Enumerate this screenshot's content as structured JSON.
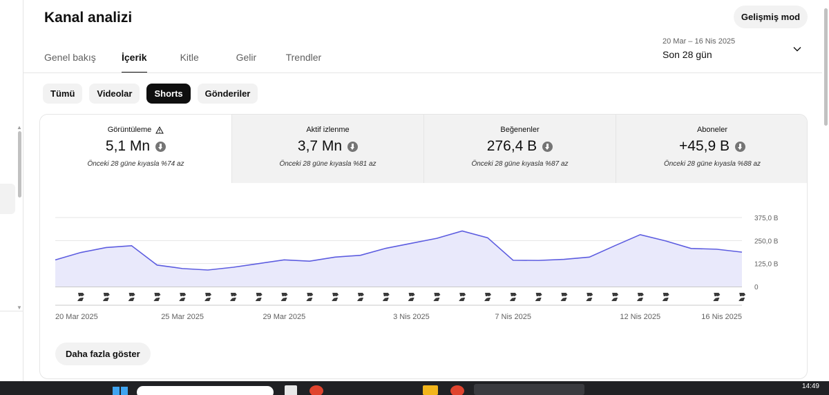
{
  "header": {
    "title": "Kanal analizi",
    "advanced_mode": "Gelişmiş mod"
  },
  "tabs": [
    {
      "label": "Genel bakış",
      "active": false
    },
    {
      "label": "İçerik",
      "active": true
    },
    {
      "label": "Kitle",
      "active": false
    },
    {
      "label": "Gelir",
      "active": false
    },
    {
      "label": "Trendler",
      "active": false
    }
  ],
  "date_picker": {
    "range": "20 Mar – 16 Nis 2025",
    "label": "Son 28 gün"
  },
  "filters": [
    {
      "label": "Tümü",
      "active": false
    },
    {
      "label": "Videolar",
      "active": false
    },
    {
      "label": "Shorts",
      "active": true
    },
    {
      "label": "Gönderiler",
      "active": false
    }
  ],
  "metrics": [
    {
      "title": "Görüntüleme",
      "value": "5,1 Mn",
      "compare": "Önceki 28 güne kıyasla %74 az",
      "warning": true,
      "active": true
    },
    {
      "title": "Aktif izlenme",
      "value": "3,7 Mn",
      "compare": "Önceki 28 güne kıyasla %81 az",
      "warning": false,
      "active": false
    },
    {
      "title": "Beğenenler",
      "value": "276,4 B",
      "compare": "Önceki 28 güne kıyasla %87 az",
      "warning": false,
      "active": false
    },
    {
      "title": "Aboneler",
      "value": "+45,9 B",
      "compare": "Önceki 28 güne kıyasla %88 az",
      "warning": false,
      "active": false
    }
  ],
  "chart_data": {
    "type": "area",
    "y_ticks": [
      {
        "value": 0,
        "label": "0"
      },
      {
        "value": 125000,
        "label": "125,0 B"
      },
      {
        "value": 250000,
        "label": "250,0 B"
      },
      {
        "value": 375000,
        "label": "375,0 B"
      }
    ],
    "ylim": [
      0,
      375000
    ],
    "x_tick_labels": [
      {
        "index": 0,
        "label": "20 Mar 2025"
      },
      {
        "index": 5,
        "label": "25 Mar 2025"
      },
      {
        "index": 9,
        "label": "29 Mar 2025"
      },
      {
        "index": 14,
        "label": "3 Nis 2025"
      },
      {
        "index": 18,
        "label": "7 Nis 2025"
      },
      {
        "index": 23,
        "label": "12 Nis 2025"
      },
      {
        "index": 27,
        "label": "16 Nis 2025"
      }
    ],
    "x": [
      "20 Mar",
      "21 Mar",
      "22 Mar",
      "23 Mar",
      "24 Mar",
      "25 Mar",
      "26 Mar",
      "27 Mar",
      "28 Mar",
      "29 Mar",
      "30 Mar",
      "31 Mar",
      "1 Nis",
      "2 Nis",
      "3 Nis",
      "4 Nis",
      "5 Nis",
      "6 Nis",
      "7 Nis",
      "8 Nis",
      "9 Nis",
      "10 Nis",
      "11 Nis",
      "12 Nis",
      "13 Nis",
      "14 Nis",
      "15 Nis",
      "16 Nis"
    ],
    "values": [
      145000,
      185000,
      212000,
      222000,
      117000,
      98000,
      90000,
      105000,
      125000,
      145000,
      138000,
      160000,
      170000,
      208000,
      235000,
      262000,
      302000,
      265000,
      143000,
      142000,
      148000,
      160000,
      222000,
      282000,
      248000,
      207000,
      203000,
      187000
    ],
    "shorts_markers": [
      true,
      true,
      true,
      true,
      true,
      true,
      true,
      true,
      true,
      true,
      true,
      true,
      true,
      true,
      true,
      true,
      true,
      true,
      true,
      true,
      true,
      true,
      true,
      true,
      false,
      true,
      true,
      true,
      true
    ],
    "grid": true,
    "line_color": "#5c5ce0",
    "fill_color": "#e9e9fb"
  },
  "show_more": "Daha fazla göster",
  "taskbar": {
    "clock": "14:49"
  }
}
